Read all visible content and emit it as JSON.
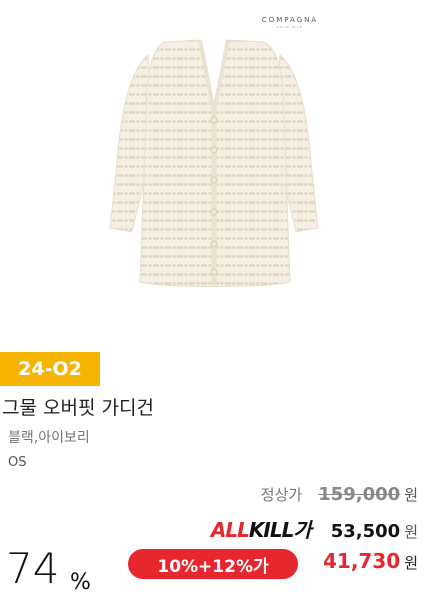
{
  "brand": {
    "name": "COMPAGNA",
    "sub": "POUR ELLE"
  },
  "product_image": {
    "alt_icon": "cardigan-image"
  },
  "season": {
    "code": "24-O2"
  },
  "product": {
    "title": "그물 오버핏 가디건",
    "colors": "블랙,아이보리",
    "size": "OS"
  },
  "price": {
    "regular_label": "정상가",
    "regular_value": "159,000",
    "allkill_logo_red": "ALL",
    "allkill_logo_black": "KILL가",
    "allkill_value": "53,500",
    "discount_badge": "10%+12%가",
    "final_value": "41,730",
    "currency": "원"
  },
  "discount": {
    "rate": "74",
    "unit": "%"
  },
  "colors": {
    "badge_yellow": "#f5b400",
    "accent_red": "#e8262d"
  }
}
